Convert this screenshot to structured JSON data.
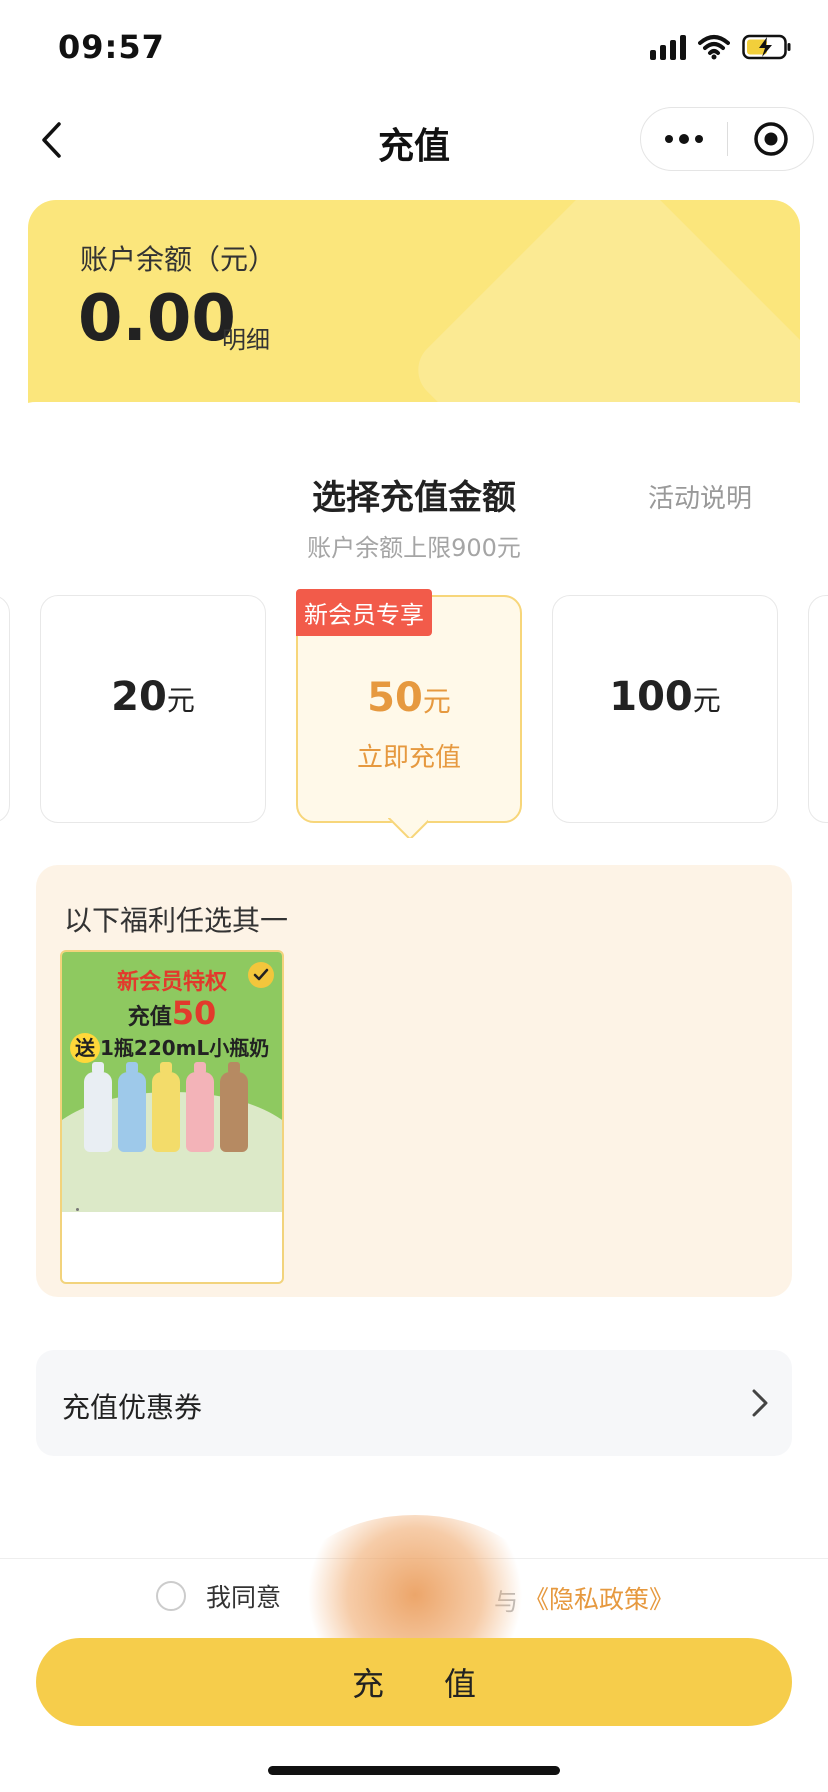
{
  "status_bar": {
    "time": "09:57"
  },
  "nav": {
    "title": "充值"
  },
  "balance": {
    "label": "账户余额（元）",
    "value": "0.00",
    "detail_link": "明细"
  },
  "section": {
    "title": "选择充值金额",
    "activity_link": "活动说明",
    "limit_text": "账户余额上限900元"
  },
  "amounts": [
    {
      "value": "20",
      "unit": "元"
    },
    {
      "value": "50",
      "unit": "元",
      "tag": "新会员专享",
      "action": "立即充值",
      "selected": true
    },
    {
      "value": "100",
      "unit": "元"
    }
  ],
  "benefits": {
    "title": "以下福利任选其一",
    "promo": {
      "line1": "新会员特权",
      "line2_prefix": "充值",
      "line2_value": "50",
      "line3_badge": "送",
      "line3_text": "1瓶220mL小瓶奶",
      "bottle_colors": [
        "#e9eef3",
        "#9ec9ea",
        "#f3dc6a",
        "#f3b3b8",
        "#b68a62"
      ]
    }
  },
  "coupon": {
    "label": "充值优惠券"
  },
  "agreement": {
    "text": "我同意",
    "connector": "与",
    "privacy": "《隐私政策》"
  },
  "pay_button": {
    "label": "充值"
  },
  "colors": {
    "accent": "#f6cd4b",
    "orange": "#e6993f",
    "tag_red": "#f25b4a"
  }
}
